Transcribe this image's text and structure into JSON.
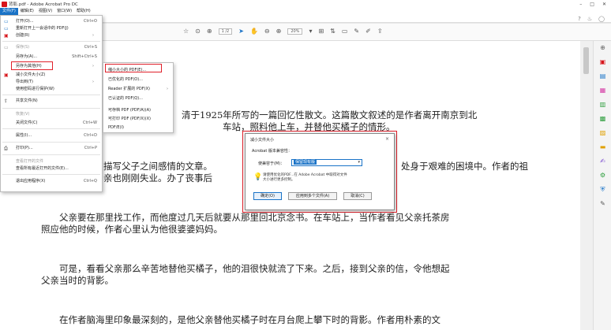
{
  "window": {
    "title": "背影.pdf - Adobe Acrobat Pro DC",
    "minimize": "–",
    "maximize": "□",
    "close": "✕"
  },
  "menubar": [
    {
      "label": "文件(F)",
      "active": true
    },
    {
      "label": "编辑(E)",
      "active": false
    },
    {
      "label": "视图(V)",
      "active": false
    },
    {
      "label": "窗口(W)",
      "active": false
    },
    {
      "label": "帮助(H)",
      "active": false
    }
  ],
  "header_icons": {
    "help": "?",
    "bell": "🔔",
    "user": "◯"
  },
  "toolbar": {
    "page_current": "1",
    "page_total": "/2",
    "zoom": "20%",
    "icons": [
      "star-icon",
      "arrow-up-icon",
      "arrow-down-icon",
      "cursor-icon",
      "hand-icon",
      "zoom-out-icon",
      "zoom-in-icon",
      "zoom-dropdown",
      "fit-icon",
      "comment-icon",
      "pen-icon",
      "highlight-icon",
      "share-icon"
    ]
  },
  "file_menu": {
    "items": [
      {
        "label": "打开(O)...",
        "shortcut": "Ctrl+O",
        "icon": "folder-icon",
        "disabled": false
      },
      {
        "label": "重新打开上一会话中的 PDF(J)",
        "shortcut": "",
        "icon": "",
        "disabled": false
      },
      {
        "label": "创建(R)",
        "shortcut": "",
        "icon": "create-icon",
        "disabled": false,
        "submenu": true
      },
      {
        "label": "保存(S)",
        "shortcut": "Ctrl+S",
        "icon": "save-icon",
        "disabled": true
      },
      {
        "label": "另存为(A)...",
        "shortcut": "Shift+Ctrl+S",
        "icon": "",
        "disabled": false
      },
      {
        "label": "另存为其他(H)",
        "shortcut": "",
        "icon": "",
        "disabled": false,
        "submenu": true
      },
      {
        "label": "减小文件大小(Z)",
        "shortcut": "",
        "icon": "reduce-icon",
        "disabled": false
      },
      {
        "label": "导出到(T)",
        "shortcut": "",
        "icon": "",
        "disabled": false,
        "submenu": true
      },
      {
        "label": "使用密码进行保护(W)",
        "shortcut": "",
        "icon": "",
        "disabled": false
      },
      {
        "label": "共享文件(N)",
        "shortcut": "",
        "icon": "share-file-icon",
        "disabled": false
      },
      {
        "label": "恢复(V)",
        "shortcut": "",
        "icon": "",
        "disabled": true
      },
      {
        "label": "关闭文件(C)",
        "shortcut": "Ctrl+W",
        "icon": "",
        "disabled": false
      },
      {
        "label": "属性(I)...",
        "shortcut": "Ctrl+D",
        "icon": "",
        "disabled": false
      },
      {
        "label": "打印(P)...",
        "shortcut": "Ctrl+P",
        "icon": "print-icon",
        "disabled": false
      },
      {
        "label": "查看打开的文件",
        "shortcut": "",
        "icon": "",
        "disabled": true
      },
      {
        "label": "查看所有最近打开的文件(E)...",
        "shortcut": "",
        "icon": "",
        "disabled": false
      },
      {
        "label": "退出应用程序(X)",
        "shortcut": "Ctrl+Q",
        "icon": "",
        "disabled": false
      }
    ]
  },
  "submenu": {
    "items": [
      {
        "label": "缩小大小的 PDF(E)...",
        "submenu": false
      },
      {
        "label": "已优化的 PDF(O)...",
        "submenu": false
      },
      {
        "label": "Reader 扩展的 PDF(X)",
        "submenu": true
      },
      {
        "label": "已认证的 PDF(Q)...",
        "submenu": false
      },
      {
        "label": "可存档 PDF (PDF/A)(A)",
        "submenu": false
      },
      {
        "label": "可打印 PDF (PDF/X)(X)",
        "submenu": false
      },
      {
        "label": "PDF/E(I)",
        "submenu": false
      }
    ]
  },
  "dialog": {
    "title": "减小文件大小",
    "close": "×",
    "section": "Acrobat 版本兼容性：",
    "label": "使兼容于(M)：",
    "selected": "保留现有版",
    "note": "请使用优化的PDF...在 Adobe Acrobat 中取得对文件大小进行更多控制。",
    "buttons": {
      "ok": "确定(O)",
      "multi": "应用到多个文件(A)",
      "cancel": "取消(C)"
    }
  },
  "document": {
    "paragraphs": [
      "清于1925年所写的一篇回忆性散文。这篇散文叙述的是作者离开南京到北",
      "车站，照料他上车，并替他买橘子的情形。",
      "描写父子之间感情的文章。",
      "处身于艰难的困境中。作者的祖",
      "亲也刚刚失业。办了丧事后",
      "父亲要在那里找工作，而他度过几天后就要从那里回北京念书。在车站上，当作者看见父亲托茶房",
      "照应他的时候，作者心里认为他很婆婆妈妈。",
      "可是，看看父亲那么辛苦地替他买橘子，他的泪很快就流了下来。之后，接到父亲的信，令他想起",
      "父亲当时的背影。",
      "在作者脑海里印象最深刻的，是他父亲替他买橘子时在月台爬上攀下时的背影。作者用朴素的文"
    ]
  },
  "right_rail": [
    "zoom-icon",
    "pdf-create-icon",
    "combine-icon",
    "edit-pdf-icon",
    "export-icon",
    "organize-icon",
    "scan-icon",
    "comment-icon",
    "sign-icon",
    "protect-icon",
    "more-tools-icon"
  ]
}
